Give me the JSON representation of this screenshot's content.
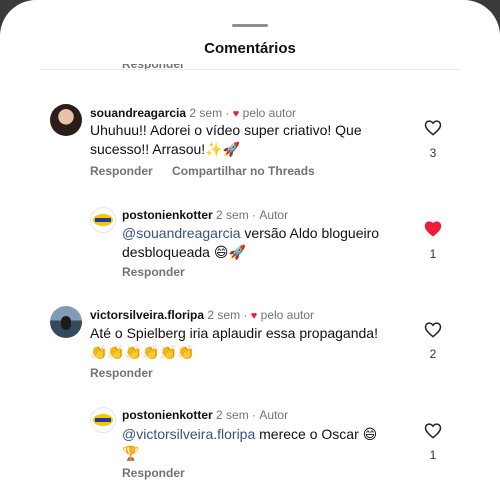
{
  "header": {
    "title": "Comentários",
    "cut_label": "Responder"
  },
  "comments": [
    {
      "user": "souandreagarcia",
      "time": "2 sem",
      "by_author": "pelo autor",
      "text_1": "Uhuhuu!! Adorei o vídeo super criativo! Que",
      "text_2": "sucesso!! Arrasou!✨🚀",
      "likes": "3",
      "liked": false,
      "reply": "Responder",
      "share": "Compartilhar no Threads"
    },
    {
      "user": "postonienkotter",
      "time": "2 sem",
      "role": "Autor",
      "mention": "@souandreagarcia",
      "text_1": " versão Aldo blogueiro",
      "text_2": "desbloqueada 😄🚀",
      "likes": "1",
      "liked": true,
      "reply": "Responder"
    },
    {
      "user": "victorsilveira.floripa",
      "time": "2 sem",
      "by_author": "pelo autor",
      "text_1": "Até o Spielberg iria aplaudir essa propaganda!",
      "text_2": "👏👏👏👏👏👏",
      "likes": "2",
      "liked": false,
      "reply": "Responder"
    },
    {
      "user": "postonienkotter",
      "time": "2 sem",
      "role": "Autor",
      "mention": "@victorsilveira.floripa",
      "text_1": " merece o Oscar 😄",
      "text_2": "🏆",
      "likes": "1",
      "liked": false,
      "reply": "Responder"
    }
  ],
  "colors": {
    "heart_red": "#ed1c3a",
    "mention_blue": "#385185",
    "meta_gray": "#737373"
  },
  "icons": {
    "like": "heart-outline-icon",
    "liked": "heart-filled-icon"
  }
}
